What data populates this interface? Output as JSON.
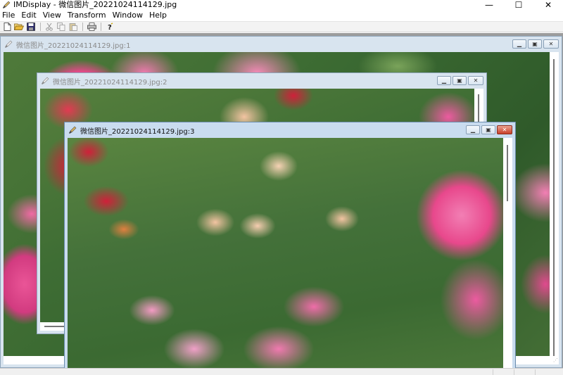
{
  "app": {
    "title": "IMDisplay - 微信图片_20221024114129.jpg",
    "controls": {
      "minimize": "—",
      "maximize": "☐",
      "close": "✕"
    }
  },
  "menu": [
    "File",
    "Edit",
    "View",
    "Transform",
    "Window",
    "Help"
  ],
  "toolbar": {
    "buttons": [
      "new-icon",
      "open-folder-icon",
      "save-icon",
      "cut-icon",
      "copy-icon",
      "paste-icon",
      "print-icon",
      "help-icon"
    ]
  },
  "windows": [
    {
      "title": "微信图片_20221024114129.jpg:1",
      "active": false
    },
    {
      "title": "微信图片_20221024114129.jpg:2",
      "active": false
    },
    {
      "title": "微信图片_20221024114129.jpg:3",
      "active": true
    }
  ],
  "colors": {
    "foliage": "#3b6a32",
    "rose_pink": "#e8488c",
    "rose_light": "#f29ac3",
    "rose_red": "#d0203a",
    "peach": "#f3c4a2",
    "active_close": "#c8412a"
  }
}
